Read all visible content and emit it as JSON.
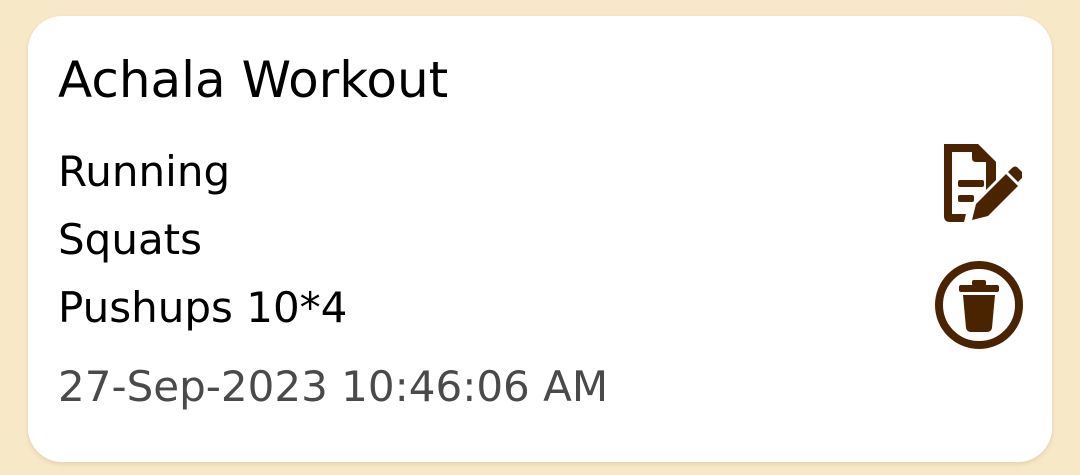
{
  "card": {
    "title": "Achala Workout",
    "exercises": [
      "Running",
      "Squats",
      "Pushups 10*4"
    ],
    "timestamp": "27-Sep-2023 10:46:06 AM"
  },
  "actions": {
    "edit_icon": "edit-document-icon",
    "delete_icon": "trash-circle-icon"
  },
  "colors": {
    "background": "#f7e8c8",
    "card": "#ffffff",
    "icon": "#4a2400",
    "text": "#000000",
    "timestamp": "#4a4a4a"
  }
}
